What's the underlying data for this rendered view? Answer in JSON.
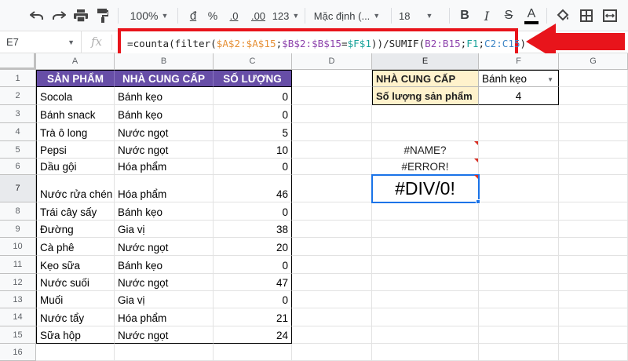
{
  "toolbar": {
    "zoom": "100%",
    "currency": "đ",
    "percent": "%",
    "dec_decrease": ".0",
    "dec_increase": ".00",
    "number_format": "123",
    "font": "Mặc định (...",
    "font_size": "18",
    "bold": "B",
    "italic": "I",
    "strike": "S",
    "text_color": "A"
  },
  "formula_bar": {
    "name_box": "E7",
    "fx": "fx",
    "formula_parts": [
      {
        "t": "=counta(filter(",
        "c": ""
      },
      {
        "t": "$A$2:$A$15",
        "c": "orange"
      },
      {
        "t": ";",
        "c": ""
      },
      {
        "t": "$B$2:$B$15",
        "c": "purple"
      },
      {
        "t": "=",
        "c": ""
      },
      {
        "t": "$F$1",
        "c": "teal"
      },
      {
        "t": "))/SUMIF(",
        "c": ""
      },
      {
        "t": "B2:B15",
        "c": "purple"
      },
      {
        "t": ";",
        "c": ""
      },
      {
        "t": "F1",
        "c": "teal"
      },
      {
        "t": ";",
        "c": ""
      },
      {
        "t": "C2:C15",
        "c": "blue"
      },
      {
        "t": ")",
        "c": ""
      }
    ]
  },
  "columns": [
    "A",
    "B",
    "C",
    "D",
    "E",
    "F",
    "G"
  ],
  "rows": [
    "1",
    "2",
    "3",
    "4",
    "5",
    "6",
    "7",
    "8",
    "9",
    "10",
    "11",
    "12",
    "13",
    "14",
    "15",
    "16"
  ],
  "table": {
    "headers": [
      "SẢN PHẨM",
      "NHÀ CUNG CẤP",
      "SỐ LƯỢNG"
    ],
    "data": [
      [
        "Socola",
        "Bánh kẹo",
        "0"
      ],
      [
        "Bánh snack",
        "Bánh kẹo",
        "0"
      ],
      [
        "Trà ô long",
        "Nước ngọt",
        "5"
      ],
      [
        "Pepsi",
        "Nước ngọt",
        "10"
      ],
      [
        "Dầu gội",
        "Hóa phẩm",
        "0"
      ],
      [
        "Nước rửa chén",
        "Hóa phẩm",
        "46"
      ],
      [
        "Trái cây sấy",
        "Bánh kẹo",
        "0"
      ],
      [
        "Đường",
        "Gia vị",
        "38"
      ],
      [
        "Cà phê",
        "Nước ngọt",
        "20"
      ],
      [
        "Kẹo sữa",
        "Bánh kẹo",
        "0"
      ],
      [
        "Nước suối",
        "Nước ngọt",
        "47"
      ],
      [
        "Muối",
        "Gia vị",
        "0"
      ],
      [
        "Nước tẩy",
        "Hóa phẩm",
        "21"
      ],
      [
        "Sữa hộp",
        "Nước ngọt",
        "24"
      ]
    ]
  },
  "lookup": {
    "label_supplier": "NHÀ CUNG CẤP",
    "value_supplier": "Bánh kẹo",
    "label_count": "Số lượng sản phẩm",
    "value_count": "4"
  },
  "errors": {
    "e5": "#NAME?",
    "e6": "#ERROR!",
    "e7": "#DIV/0!"
  },
  "colors": {
    "header_purple": "#674ea7",
    "label_yellow": "#fff2cc",
    "highlight_red": "#e8141b",
    "selection_blue": "#1a73e8"
  }
}
